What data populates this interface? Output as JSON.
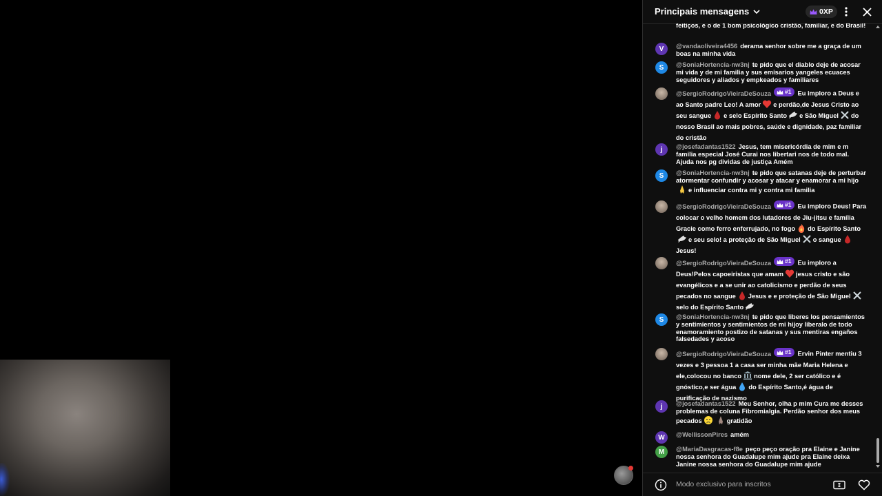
{
  "header": {
    "title": "Principais mensagens",
    "xp_label": "0XP"
  },
  "colors": {
    "panel_bg": "#0f0f0f",
    "badge_purple": "#6a33c9",
    "avatar_v": "#5e35b1",
    "avatar_s": "#1e88e5",
    "avatar_j": "#5e35b1",
    "avatar_w": "#5e35b1",
    "avatar_m": "#43a047"
  },
  "messages": [
    {
      "author": "",
      "avatar": "",
      "text": "feitiços, e o de 1 bom psicológico cristão, familiar, e do Brasil!"
    },
    {
      "author": "@vandaoliveira4456",
      "avatar": "V",
      "text": "derama senhor sobre me a graça de um boas na minha vida"
    },
    {
      "author": "@SoniaHortencia-nw3nj",
      "avatar": "S",
      "text": "te pido que el diablo deje de acosar mi vida y de mi familia y sus emisarios yangeles ecuaces seguidores y aliados y empkeados y familiares"
    },
    {
      "author": "@SergioRodrigoVieiraDeSouza",
      "badge": "#1",
      "parts": [
        "Eu imploro a Deus e ao Santo padre Leo! A amor",
        "e perdão,de Jesus Cristo ao seu sangue",
        "e selo Espírito Santo",
        "e São Miguel",
        "do nosso Brasil ao mais pobres, saúde e dignidade, paz familiar do cristão"
      ]
    },
    {
      "author": "@josefadantas1522",
      "avatar": "j",
      "text": "Jesus, tem misericórdia de mim e m familia especial José Curai nos libertari nos de todo mal. Ajuda nos pg dividas de justiça Amém"
    },
    {
      "author": "@SoniaHortencia-nw3nj",
      "avatar": "S",
      "parts": [
        "te pido que satanas deje de perturbar atormentar confundir y acosar y atacar y enamorar a mi hijo",
        "e influenciar contra mi y contra mi familia"
      ]
    },
    {
      "author": "@SergioRodrigoVieiraDeSouza",
      "badge": "#1",
      "parts": [
        "Eu imploro Deus! Para colocar o velho homem dos lutadores de Jiu-jitsu e família Gracie como ferro enferrujado, no fogo",
        "do Espírito Santo",
        "e seu selo! a proteção de São Miguel",
        "o sangue",
        "Jesus!"
      ]
    },
    {
      "author": "@SergioRodrigoVieiraDeSouza",
      "badge": "#1",
      "parts": [
        "Eu imploro a Deus!Pelos capoeiristas que amam",
        "jesus cristo e são evangélicos e a se unir ao catolicismo e perdão de seus pecados no sangue",
        "Jesus e e proteção de São Miguel",
        "selo do Espírito Santo"
      ]
    },
    {
      "author": "@SoniaHortencia-nw3nj",
      "avatar": "S",
      "text": "te pido que liberes los pensamientos y sentimientos y sentimientos de mi hijoy liberalo de todo enamoramiento postizo de satanas y sus mentiras engaños falsedades y acoso"
    },
    {
      "author": "@SergioRodrigoVieiraDeSouza",
      "badge": "#1",
      "parts": [
        "Ervin Pinter mentiu 3 vezes e 3 pessoa 1 a casa ser minha mãe Maria Helena e ele,colocou no banco",
        "nome dele, 2 ser católico e é gnóstico,e ser água",
        "do Espírito Santo,é água de purificação de nazismo"
      ]
    },
    {
      "author": "@josefadantas1522",
      "avatar": "j",
      "parts": [
        "Meu Senhor, olha p mim Cura me desses problemas de coluna Fibromialgia. Perdão senhor dos meus pecados",
        "gratidão"
      ]
    },
    {
      "author": "@WellissonPires",
      "avatar": "W",
      "text": "amém"
    },
    {
      "author": "@MariaDasgracas-f8e",
      "avatar": "M",
      "text": "peço peço oração pra Elaine e Janine nossa senhora do Guadalupe mim ajude pra Elaine deixa Janine nossa senhora do Guadalupe mim ajude"
    }
  ],
  "footer": {
    "members_only_text": "Modo exclusivo para inscritos"
  }
}
